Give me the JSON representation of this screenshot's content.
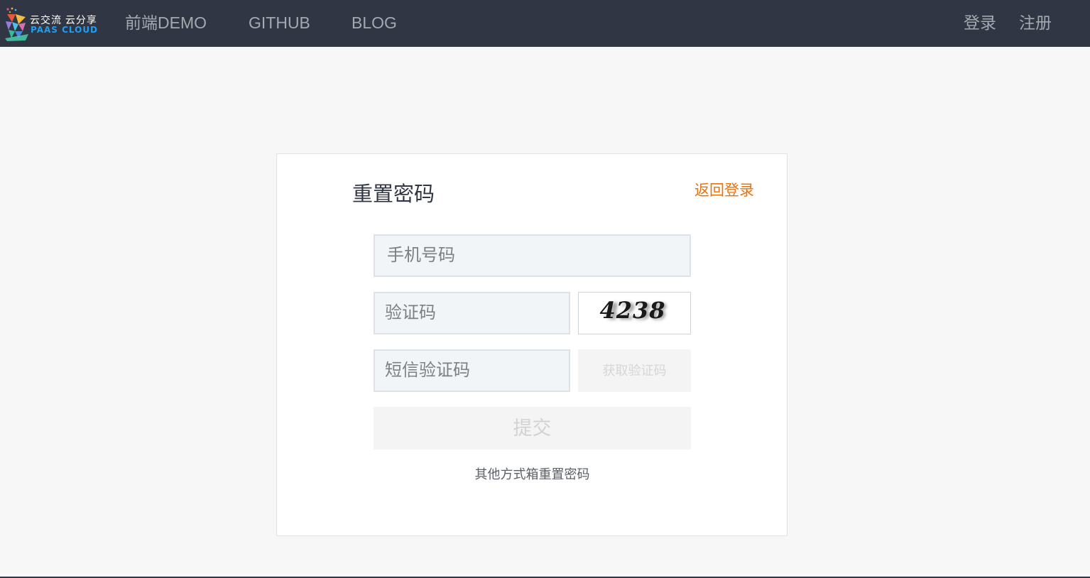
{
  "navbar": {
    "logo": {
      "line1": "云交流 云分享",
      "line2": "PAAS CLOUD"
    },
    "links": [
      {
        "label": "前端DEMO"
      },
      {
        "label": "GITHUB"
      },
      {
        "label": "BLOG"
      }
    ],
    "login_label": "登录",
    "register_label": "注册",
    "colors": {
      "background": "#303643",
      "text": "#a4a9b1"
    }
  },
  "form": {
    "title": "重置密码",
    "back_to_login": "返回登录",
    "phone": {
      "placeholder": "手机号码",
      "value": ""
    },
    "captcha": {
      "placeholder": "验证码",
      "value": "",
      "image_text": "4238"
    },
    "sms_code": {
      "placeholder": "短信验证码",
      "value": ""
    },
    "get_code_button": "获取验证码",
    "submit_button": "提交",
    "other_method_link": "其他方式箱重置密码",
    "colors": {
      "accent": "#e7720d",
      "field_bg": "#f2f5f8"
    }
  }
}
